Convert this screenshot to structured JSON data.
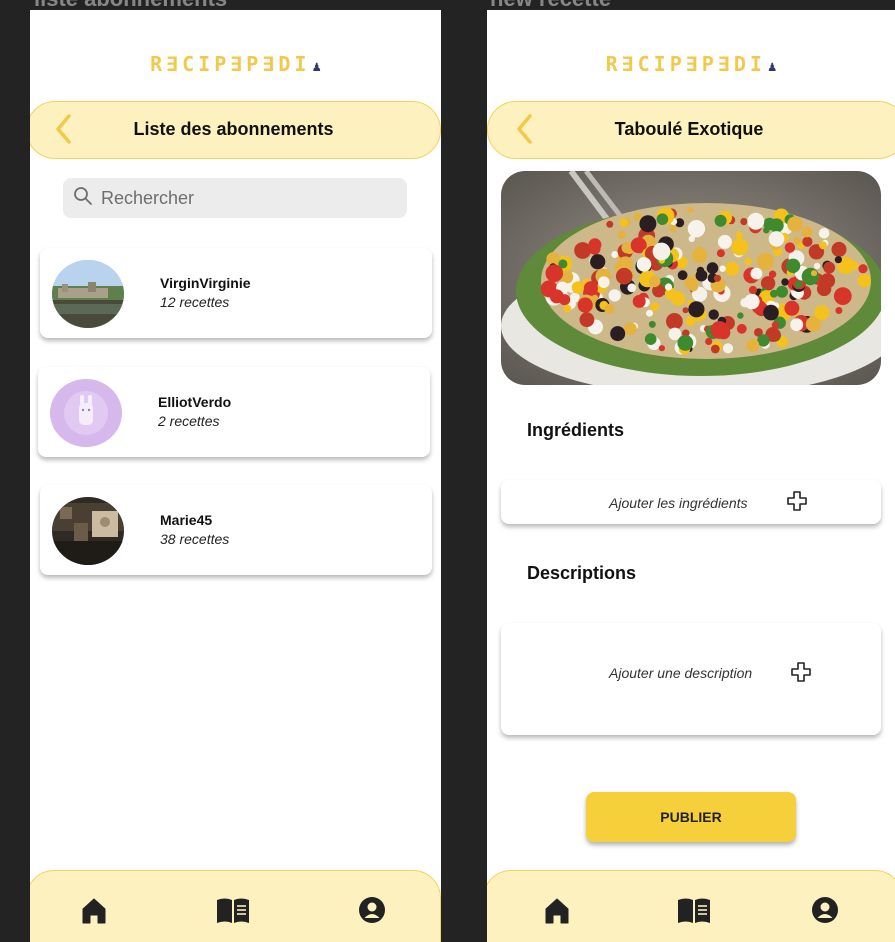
{
  "left_screen": {
    "frame_label": "liste abonnements",
    "logo": {
      "text": "RECIPEPEDIA",
      "main": "R∃CIP∃P∃DI",
      "mark": "♟"
    },
    "header": {
      "title": "Liste des abonnements",
      "back_icon": "chevron-left-icon"
    },
    "search": {
      "placeholder": "Rechercher",
      "value": "",
      "icon": "search-icon"
    },
    "users": [
      {
        "name": "VirginVirginie",
        "count": "12 recettes"
      },
      {
        "name": "ElliotVerdo",
        "count": "2 recettes"
      },
      {
        "name": "Marie45",
        "count": "38 recettes"
      }
    ],
    "nav": {
      "items": [
        "home-icon",
        "book-icon",
        "account-icon"
      ]
    }
  },
  "right_screen": {
    "frame_label": "new recette",
    "logo": {
      "text": "RECIPEPEDIA",
      "main": "R∃CIP∃P∃DI",
      "mark": "♟"
    },
    "header": {
      "title": "Taboulé Exotique",
      "back_icon": "chevron-left-icon"
    },
    "sections": {
      "ingredients_title": "Ingrédients",
      "ingredients_add": "Ajouter les ingrédients",
      "descriptions_title": "Descriptions",
      "descriptions_add": "Ajouter une description"
    },
    "publish_label": "PUBLIER",
    "nav": {
      "items": [
        "home-icon",
        "book-icon",
        "account-icon"
      ]
    }
  },
  "colors": {
    "accent_yellow": "#f2c94c",
    "header_fill": "#fdf1bf",
    "button_yellow": "#f5d03a",
    "outer_background": "#232323"
  }
}
